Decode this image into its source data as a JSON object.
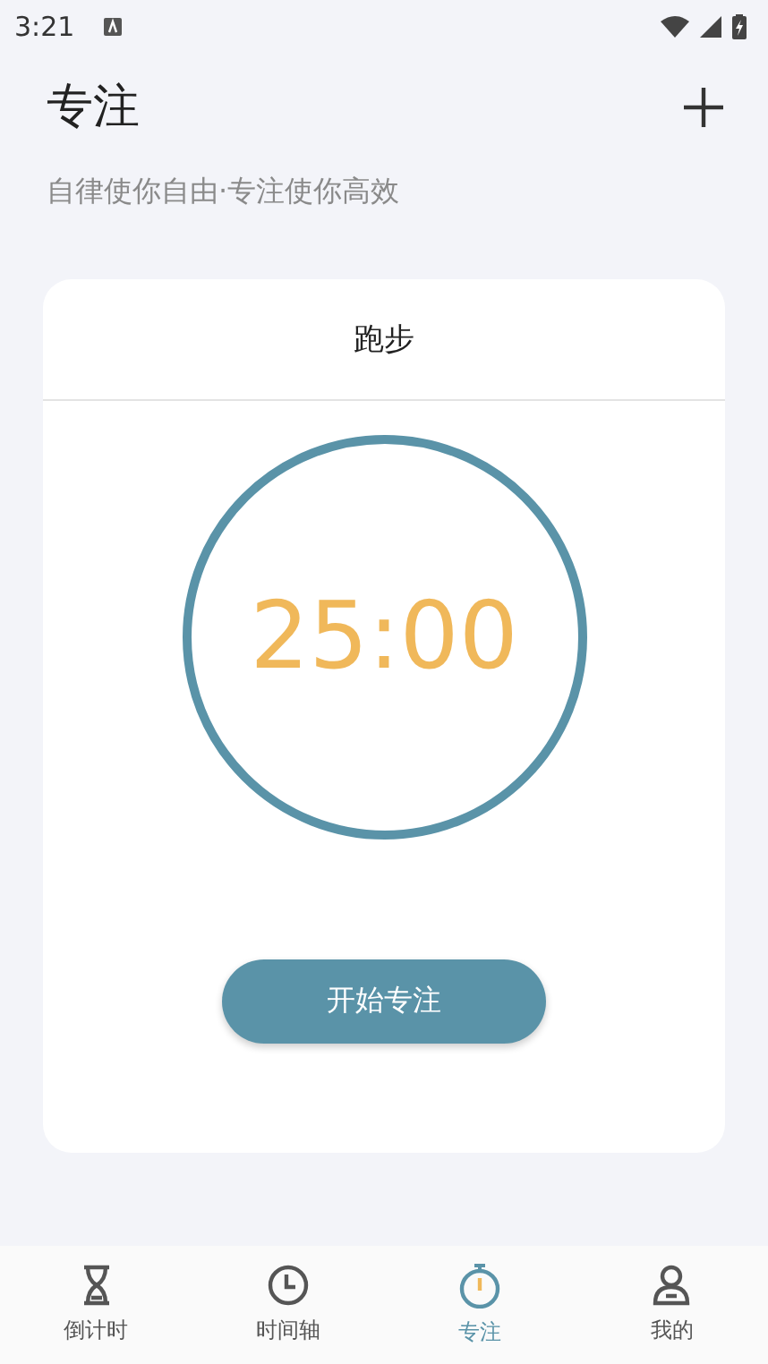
{
  "status_bar": {
    "time": "3:21"
  },
  "header": {
    "title": "专注",
    "subtitle": "自律使你自由·专注使你高效"
  },
  "card": {
    "title": "跑步",
    "timer": "25:00",
    "button": "开始专注"
  },
  "tabs": [
    {
      "label": "倒计时",
      "kind": "hourglass",
      "selected": false
    },
    {
      "label": "时间轴",
      "kind": "clock",
      "selected": false
    },
    {
      "label": "专注",
      "kind": "stopwatch",
      "selected": true
    },
    {
      "label": "我的",
      "kind": "person",
      "selected": false
    }
  ]
}
